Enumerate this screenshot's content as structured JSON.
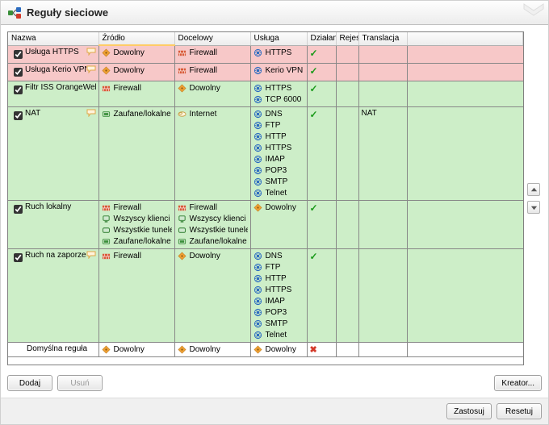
{
  "title": "Reguły sieciowe",
  "columns": {
    "name": "Nazwa",
    "source": "Źródło",
    "dest": "Docelowy",
    "service": "Usługa",
    "action": "Działanie",
    "reject": "Rejestracja",
    "translation": "Translacja"
  },
  "rows": [
    {
      "rowClass": "red",
      "checked": true,
      "bubble": true,
      "name": "Usługa HTTPS",
      "source": [
        {
          "icon": "any",
          "text": "Dowolny"
        }
      ],
      "dest": [
        {
          "icon": "fw",
          "text": "Firewall"
        }
      ],
      "service": [
        {
          "icon": "svc",
          "text": "HTTPS"
        }
      ],
      "action": "tick",
      "translation": ""
    },
    {
      "rowClass": "red",
      "checked": true,
      "bubble": true,
      "name": "Usługa Kerio VPN",
      "source": [
        {
          "icon": "any",
          "text": "Dowolny"
        }
      ],
      "dest": [
        {
          "icon": "fw",
          "text": "Firewall"
        }
      ],
      "service": [
        {
          "icon": "svc",
          "text": "Kerio VPN"
        }
      ],
      "action": "tick",
      "translation": ""
    },
    {
      "rowClass": "green",
      "checked": true,
      "bubble": false,
      "name": "Filtr ISS OrangeWeb Filter",
      "source": [
        {
          "icon": "fw",
          "text": "Firewall"
        }
      ],
      "dest": [
        {
          "icon": "any",
          "text": "Dowolny"
        }
      ],
      "service": [
        {
          "icon": "svc",
          "text": "HTTPS"
        },
        {
          "icon": "svc",
          "text": "TCP 6000"
        }
      ],
      "action": "tick",
      "translation": ""
    },
    {
      "rowClass": "green",
      "checked": true,
      "bubble": true,
      "name": "NAT",
      "source": [
        {
          "icon": "trust",
          "text": "Zaufane/lokalne"
        }
      ],
      "dest": [
        {
          "icon": "inet",
          "text": "Internet"
        }
      ],
      "service": [
        {
          "icon": "svc",
          "text": "DNS"
        },
        {
          "icon": "svc",
          "text": "FTP"
        },
        {
          "icon": "svc",
          "text": "HTTP"
        },
        {
          "icon": "svc",
          "text": "HTTPS"
        },
        {
          "icon": "svc",
          "text": "IMAP"
        },
        {
          "icon": "svc",
          "text": "POP3"
        },
        {
          "icon": "svc",
          "text": "SMTP"
        },
        {
          "icon": "svc",
          "text": "Telnet"
        }
      ],
      "action": "tick",
      "translation": "NAT"
    },
    {
      "rowClass": "green",
      "checked": true,
      "bubble": false,
      "name": "Ruch lokalny",
      "source": [
        {
          "icon": "fw",
          "text": "Firewall"
        },
        {
          "icon": "vpn",
          "text": "Wszyscy klienci VPN"
        },
        {
          "icon": "tun",
          "text": "Wszystkie tunele VPN"
        },
        {
          "icon": "trust",
          "text": "Zaufane/lokalne"
        }
      ],
      "dest": [
        {
          "icon": "fw",
          "text": "Firewall"
        },
        {
          "icon": "vpn",
          "text": "Wszyscy klienci VPN"
        },
        {
          "icon": "tun",
          "text": "Wszystkie tunele VPN"
        },
        {
          "icon": "trust",
          "text": "Zaufane/lokalne"
        }
      ],
      "service": [
        {
          "icon": "any",
          "text": "Dowolny"
        }
      ],
      "action": "tick",
      "translation": ""
    },
    {
      "rowClass": "green",
      "checked": true,
      "bubble": true,
      "name": "Ruch na zaporze",
      "source": [
        {
          "icon": "fw",
          "text": "Firewall"
        }
      ],
      "dest": [
        {
          "icon": "any",
          "text": "Dowolny"
        }
      ],
      "service": [
        {
          "icon": "svc",
          "text": "DNS"
        },
        {
          "icon": "svc",
          "text": "FTP"
        },
        {
          "icon": "svc",
          "text": "HTTP"
        },
        {
          "icon": "svc",
          "text": "HTTPS"
        },
        {
          "icon": "svc",
          "text": "IMAP"
        },
        {
          "icon": "svc",
          "text": "POP3"
        },
        {
          "icon": "svc",
          "text": "SMTP"
        },
        {
          "icon": "svc",
          "text": "Telnet"
        }
      ],
      "action": "tick",
      "translation": ""
    },
    {
      "rowClass": "white",
      "checked": null,
      "bubble": false,
      "name": "Domyślna reguła",
      "nameIndent": true,
      "source": [
        {
          "icon": "any",
          "text": "Dowolny"
        }
      ],
      "dest": [
        {
          "icon": "any",
          "text": "Dowolny"
        }
      ],
      "service": [
        {
          "icon": "any",
          "text": "Dowolny"
        }
      ],
      "action": "deny",
      "translation": ""
    }
  ],
  "buttons": {
    "add": "Dodaj",
    "remove": "Usuń",
    "wizard": "Kreator...",
    "apply": "Zastosuj",
    "reset": "Resetuj"
  }
}
